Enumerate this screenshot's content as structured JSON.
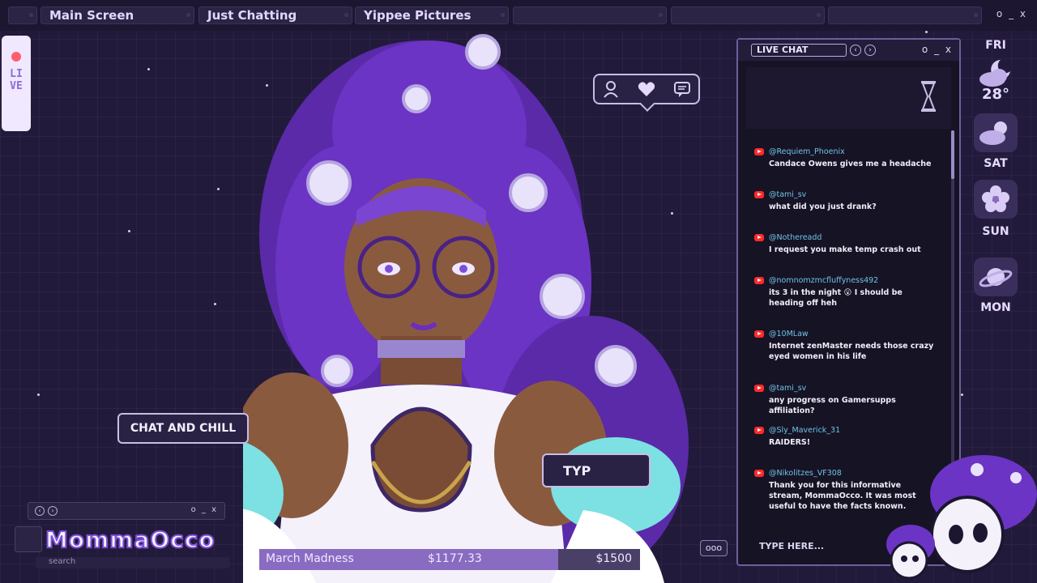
{
  "tabs": [
    {
      "label": "Main Screen"
    },
    {
      "label": "Just Chatting"
    },
    {
      "label": "Yippee Pictures"
    },
    {
      "label": ""
    },
    {
      "label": ""
    },
    {
      "label": ""
    }
  ],
  "window_controls": "o _ x",
  "live_badge": {
    "text": "LIVE"
  },
  "bubbles": {
    "chat_and_chill": "CHAT AND CHILL",
    "typ": "TYP"
  },
  "logo": {
    "text": "MommaOcco"
  },
  "mini_window_controls": "o _ x",
  "search_label": "search",
  "goal": {
    "name": "March Madness",
    "current": "$1177.33",
    "target": "$1500",
    "progress_fraction": 0.785,
    "colors": {
      "fill": "#8a6bc2",
      "track": "#4a3f66"
    }
  },
  "more_button": "ooo",
  "chat": {
    "title": "LIVE CHAT",
    "controls": "o _ x",
    "input_placeholder": "TYPE HERE...",
    "messages": [
      {
        "user": "@Requiem_Phoenix",
        "text": "Candace Owens gives me a headache"
      },
      {
        "user": "@tami_sv",
        "text": "what did you just drank?"
      },
      {
        "user": "@Nothereadd",
        "text": "I request you make temp crash out"
      },
      {
        "user": "@nomnomzmcfluffyness492",
        "text": "its 3 in the night 😮 I should be heading off heh"
      },
      {
        "user": "@10MLaw",
        "text": "Internet zenMaster needs those crazy eyed women in his life"
      },
      {
        "user": "@tami_sv",
        "text": "any progress on Gamersupps affiliation?"
      },
      {
        "user": "@Sly_Maverick_31",
        "text": "RAIDERS!"
      },
      {
        "user": "@Nikolitzes_VF308",
        "text": "Thank you for this informative stream, MommaOcco. It was most useful to have the facts known."
      }
    ]
  },
  "forecast": {
    "days": [
      {
        "day": "FRI",
        "temp": "28°",
        "icon": "moon-cloud-icon"
      },
      {
        "day": "SAT",
        "icon": "sun-cloud-icon"
      },
      {
        "day": "SUN",
        "icon": "flower-icon"
      },
      {
        "day": "MON",
        "icon": "planet-icon"
      }
    ]
  },
  "colors": {
    "background": "#221a3a",
    "accent": "#8a6bc2",
    "username": "#6fc4e3",
    "live": "#ff5f6e"
  }
}
